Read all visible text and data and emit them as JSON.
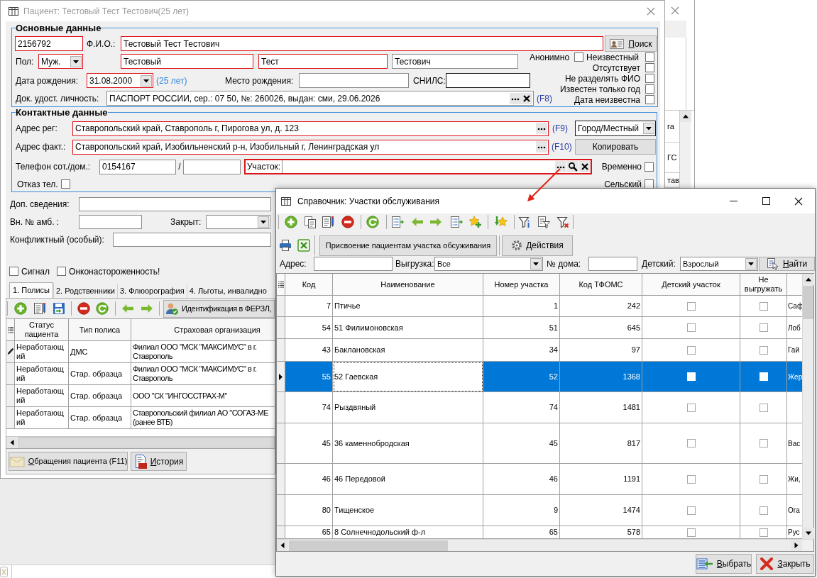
{
  "patient_window": {
    "title": "Пациент: Тестовый Тест Тестович(25 лет)",
    "main_data": {
      "title": "Основные данные",
      "card_number": {
        "value": "2156792",
        "invalid": true
      },
      "full_name_label": "Ф.И.О.:",
      "full_name": {
        "value": "Тестовый Тест Тестович",
        "invalid": true
      },
      "search_button": "Поиск",
      "sex_label": "Пол:",
      "sex": {
        "value": "Муж.",
        "invalid": true
      },
      "last_name": {
        "value": "Тестовый",
        "invalid": true
      },
      "first_name": {
        "value": "Тест",
        "invalid": true
      },
      "patronymic": {
        "value": "Тестович",
        "invalid": false
      },
      "birth_date_label": "Дата рождения:",
      "birth_date": {
        "value": "31.08.2000",
        "invalid": true
      },
      "age": "(25 лет)",
      "birth_place_label": "Место рождения:",
      "birth_place": {
        "invalid": false
      },
      "snils_label": "СНИЛС:",
      "snils": {
        "invalid": false
      },
      "document_label": "Док. удост. личность:",
      "document": {
        "value": "ПАСПОРТ РОССИИ, сер.: 07 50, №: 260026, выдан: сми, 29.06.2026",
        "invalid": false
      },
      "document_hotkey": "(F8)",
      "flags": [
        {
          "label": "Анонимно",
          "checked": false
        },
        {
          "label": "Неизвестный",
          "checked": false
        },
        {
          "label": "Отсутствует",
          "checked": false
        },
        {
          "label": "Не разделять ФИО",
          "checked": false
        },
        {
          "label": "Известен только год",
          "checked": false
        },
        {
          "label": "Дата неизвестна",
          "checked": false
        }
      ]
    },
    "contact_data": {
      "title": "Контактные данные",
      "reg_address_label": "Адрес рег:",
      "reg_address": {
        "value": "Ставропольский край, Ставрополь г, Пирогова ул, д. 123",
        "invalid": true
      },
      "reg_address_hotkey": "(F9)",
      "locality": {
        "value": "Город/Местный",
        "invalid": false
      },
      "fact_address_label": "Адрес факт.:",
      "fact_address": {
        "value": "Ставропольский край, Изобильненский р-н, Изобильный г, Ленинградская ул",
        "invalid": true
      },
      "fact_address_hotkey": "(F10)",
      "copy_button": "Копировать",
      "phone_label": "Телефон сот./дом.:",
      "mobile_phone": {
        "value": "0154167",
        "invalid": false
      },
      "phone_separator": "/",
      "home_phone": {
        "invalid": false
      },
      "district_label": "Участок:",
      "district": {
        "invalid": true
      },
      "temporary": {
        "label": "Временно",
        "checked": false
      },
      "phone_refusal": {
        "label": "Отказ тел.",
        "checked": false
      },
      "rural": {
        "label": "Сельский",
        "checked": false
      }
    },
    "extra": {
      "additional_info_label": "Доп. сведения:",
      "additional_info": {
        "invalid": false
      },
      "amb_number_label": "Вн. № амб. :",
      "amb_number": {
        "invalid": false
      },
      "closed_label": "Закрыт:",
      "closed": {
        "invalid": false
      },
      "conflict_label": "Конфликтный (особый):",
      "conflict": {
        "invalid": false
      }
    },
    "alerts": [
      {
        "label": "Сигнал",
        "checked": false
      },
      {
        "label": "Онконастороженность!",
        "checked": false
      }
    ],
    "tabs": [
      {
        "label": "1. Полисы",
        "selected": true
      },
      {
        "label": "2. Родственники",
        "selected": false
      },
      {
        "label": "3. Флюорография",
        "selected": false
      },
      {
        "label": "4. Льготы, инвалидно",
        "selected": false
      }
    ],
    "identify_button": "Идентификация в ФЕРЗЛ,",
    "policies": {
      "columns": [
        "Статус пациента",
        "Тип полиса",
        "Страховая организация"
      ],
      "rows": [
        {
          "current": true,
          "status": "Неработающий",
          "type": "ДМС",
          "insurer": "Филиал ООО \"МСК \"МАКСИМУС\" в г. Ставрополь"
        },
        {
          "current": false,
          "status": "Неработающий",
          "type": "Стар. образца",
          "insurer": "Филиал ООО \"МСК \"МАКСИМУС\" в г. Ставрополь"
        },
        {
          "current": false,
          "status": "Неработающий",
          "type": "Стар. образца",
          "insurer": "ООО \"СК \"ИНГОССТРАХ-М\""
        },
        {
          "current": false,
          "status": "Неработающий",
          "type": "Стар. образца",
          "insurer": "Ставропольский филиал АО \"СОГАЗ-МЕ\n(ранее ВТБ)"
        }
      ]
    },
    "visits_button": "Обращения пациента (F11)",
    "history_button": "История"
  },
  "background_window": {
    "cells": [
      "га",
      "ГС",
      "тав"
    ]
  },
  "reference_dialog": {
    "title": "Справочник: Участки обслуживания",
    "assign_button": "Присвоение пациентам участка обсуживания",
    "actions_button": "Действия",
    "filters": {
      "address_label": "Адрес:",
      "export_label": "Выгрузка:",
      "export": {
        "value": "Все"
      },
      "house_label": "№ дома:",
      "children_label": "Детский:",
      "children": {
        "value": "Взрослый"
      },
      "find_button": "Найти"
    },
    "table": {
      "columns": [
        "Код",
        "Наименование",
        "Номер участка",
        "Код ТФОМС",
        "Детский участок",
        "Не выгружать"
      ],
      "rows": [
        {
          "code": "7",
          "name": "Птичье",
          "number": "1",
          "tfoms": "242",
          "children_district": false,
          "no_export": false,
          "column_7": "Саф",
          "selected": false
        },
        {
          "code": "54",
          "name": "51 Филимоновская",
          "number": "51",
          "tfoms": "645",
          "children_district": false,
          "no_export": false,
          "column_7": "Лоб",
          "selected": false
        },
        {
          "code": "43",
          "name": "Баклановская",
          "number": "34",
          "tfoms": "97",
          "children_district": false,
          "no_export": false,
          "column_7": "Гай",
          "selected": false
        },
        {
          "code": "55",
          "name": "52 Гаевская",
          "number": "52",
          "tfoms": "1368",
          "children_district": false,
          "no_export": false,
          "column_7": "Жер",
          "selected": true
        },
        {
          "code": "74",
          "name": "Рыздвяный",
          "number": "74",
          "tfoms": "1481",
          "children_district": false,
          "no_export": false,
          "selected": false
        },
        {
          "code": "45",
          "name": "36 каменнобродская",
          "number": "45",
          "tfoms": "817",
          "children_district": false,
          "no_export": false,
          "column_7": "Вас",
          "selected": false
        },
        {
          "code": "46",
          "name": "46 Передовой",
          "number": "46",
          "tfoms": "1191",
          "children_district": false,
          "no_export": false,
          "column_7": "Жи,",
          "selected": false
        },
        {
          "code": "80",
          "name": "Тищенское",
          "number": "9",
          "tfoms": "1474",
          "children_district": false,
          "no_export": false,
          "column_7": "Ога",
          "selected": false
        },
        {
          "code": "65",
          "name": "8 Солнечнодольский ф-л",
          "number": "65",
          "tfoms": "578",
          "children_district": false,
          "no_export": false,
          "column_7": "Рус",
          "selected": false
        }
      ]
    },
    "select_button": "Выбрать",
    "close_button": "Закрыть"
  }
}
